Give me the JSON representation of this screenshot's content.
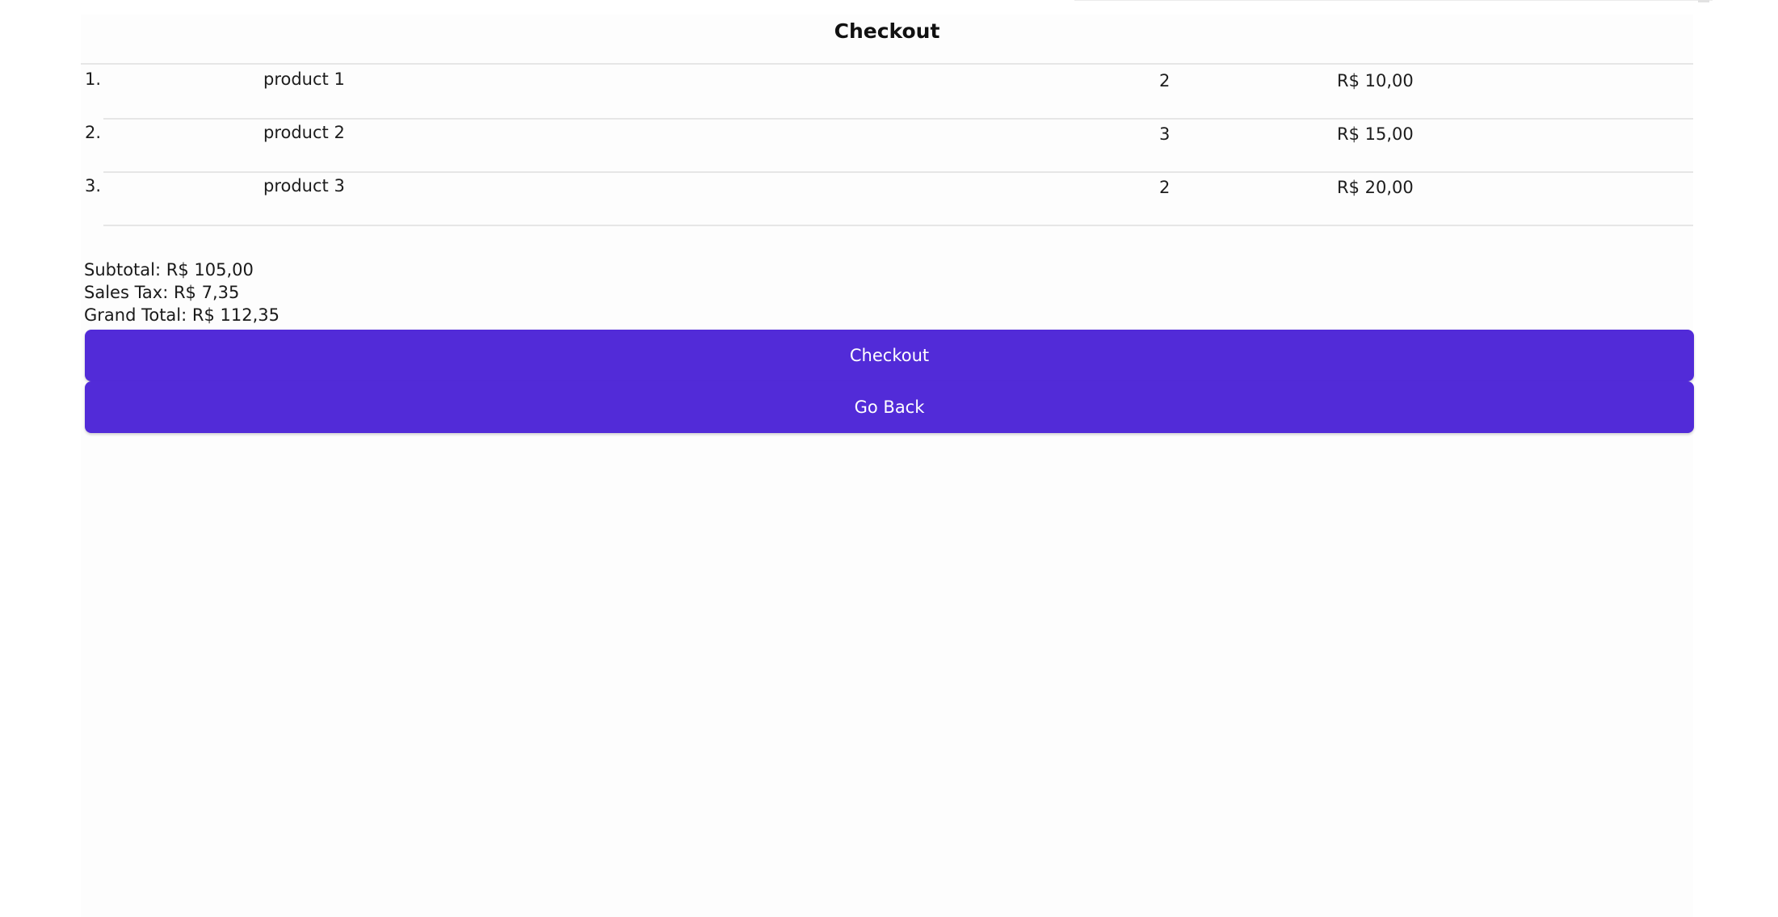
{
  "header": {
    "title": "Checkout"
  },
  "cart": {
    "items": [
      {
        "index": "1.",
        "name": "product 1",
        "quantity": "2",
        "price": "R$ 10,00"
      },
      {
        "index": "2.",
        "name": "product 2",
        "quantity": "3",
        "price": "R$ 15,00"
      },
      {
        "index": "3.",
        "name": "product 3",
        "quantity": "2",
        "price": "R$ 20,00"
      }
    ]
  },
  "summary": {
    "subtotal": "Subtotal: R$ 105,00",
    "sales_tax": "Sales Tax: R$ 7,35",
    "grand_total": "Grand Total: R$ 112,35"
  },
  "actions": {
    "checkout_label": "Checkout",
    "go_back_label": "Go Back"
  },
  "colors": {
    "accent": "#522bd8",
    "background": "#fdfdfd",
    "divider": "#e6e6e6"
  }
}
